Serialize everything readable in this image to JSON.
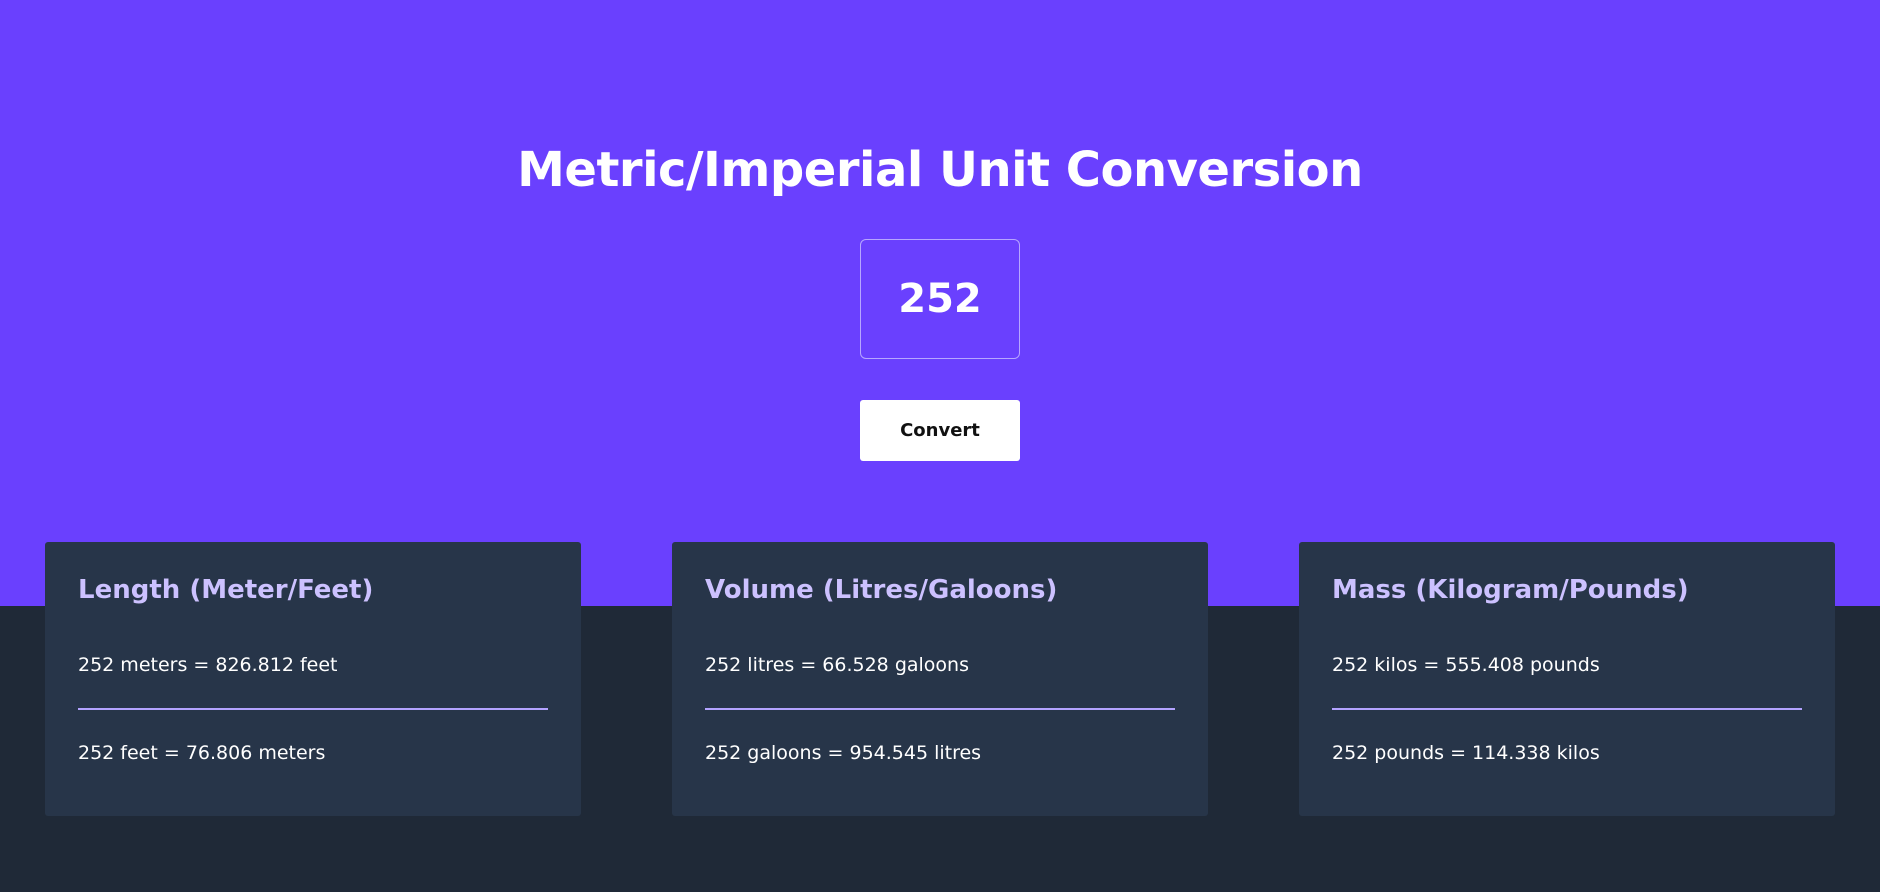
{
  "colors": {
    "hero_background": "#6a40fe",
    "page_background": "#1f2937",
    "card_background": "#273549",
    "card_title": "#ccc1ff",
    "divider": "#b3a3ff",
    "text": "#ffffff"
  },
  "header": {
    "title": "Metric/Imperial Unit Conversion"
  },
  "converter": {
    "input_value": "252",
    "convert_label": "Convert"
  },
  "cards": [
    {
      "title": "Length (Meter/Feet)",
      "result_1": "252 meters = 826.812 feet",
      "result_2": "252 feet = 76.806 meters"
    },
    {
      "title": "Volume (Litres/Galoons)",
      "result_1": "252 litres = 66.528 galoons",
      "result_2": "252 galoons = 954.545 litres"
    },
    {
      "title": "Mass (Kilogram/Pounds)",
      "result_1": "252 kilos = 555.408 pounds",
      "result_2": "252 pounds = 114.338 kilos"
    }
  ]
}
